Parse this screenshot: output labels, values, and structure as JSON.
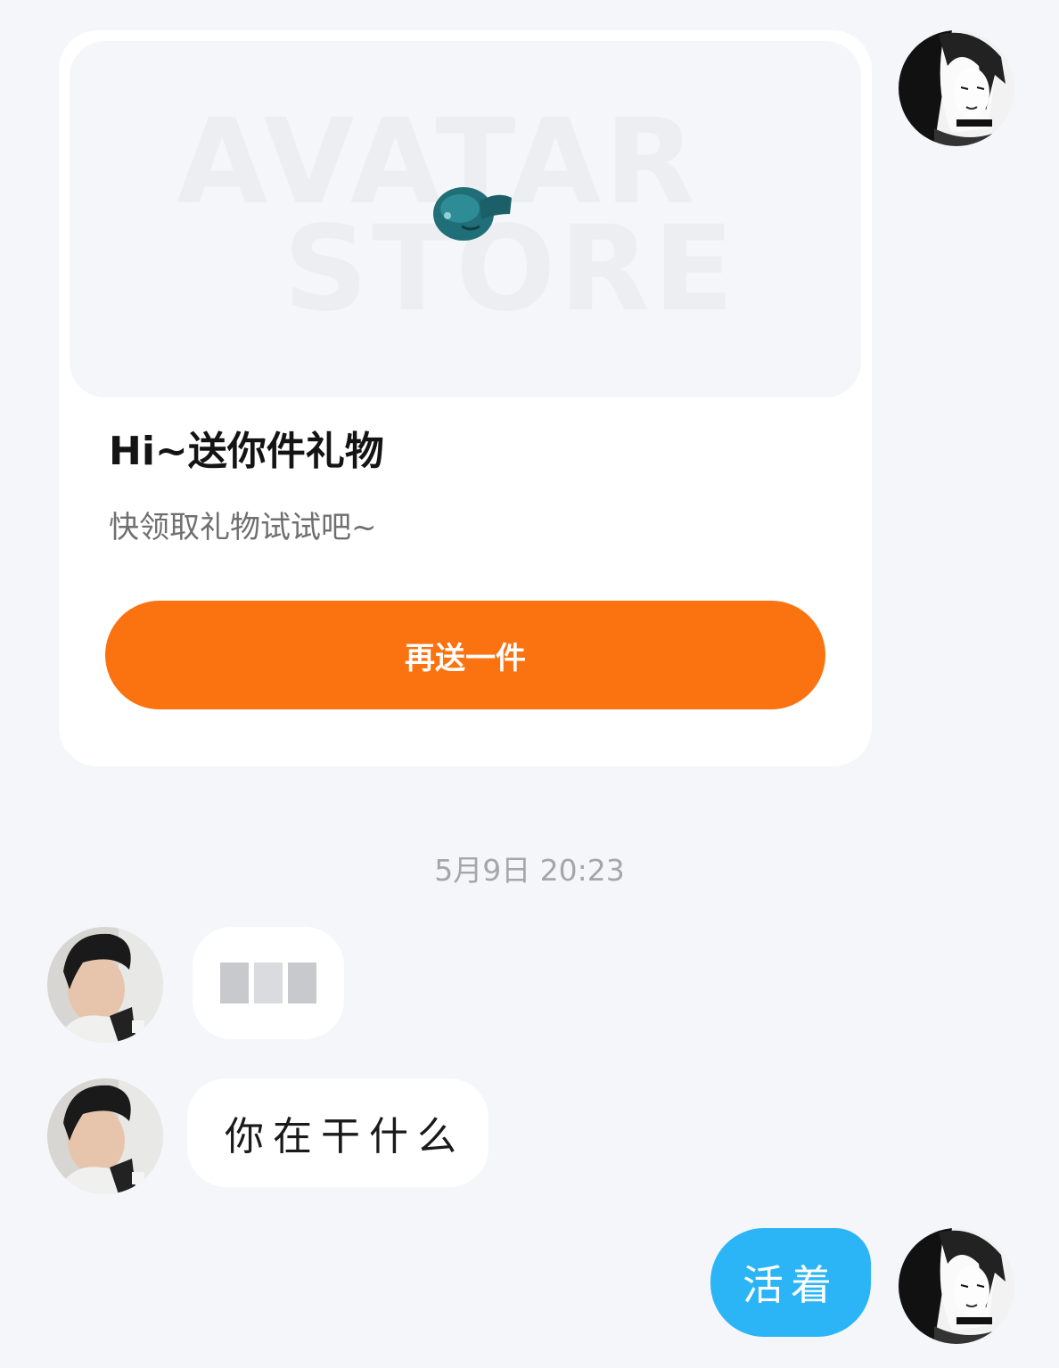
{
  "gift_card": {
    "banner_watermark_line1": "AVATAR",
    "banner_watermark_line2": "STORE",
    "title": "Hi~送你件礼物",
    "subtitle": "快领取礼物试试吧~",
    "button_label": "再送一件",
    "button_color": "#fb7310"
  },
  "timestamp": "5月9日 20:23",
  "messages": [
    {
      "sender": "other",
      "text": "",
      "blurred": true
    },
    {
      "sender": "other",
      "text": "你在干什么"
    },
    {
      "sender": "me",
      "text": "活着"
    }
  ],
  "colors": {
    "background": "#f4f6fa",
    "my_bubble": "#2bb5f6",
    "other_bubble": "#ffffff"
  }
}
